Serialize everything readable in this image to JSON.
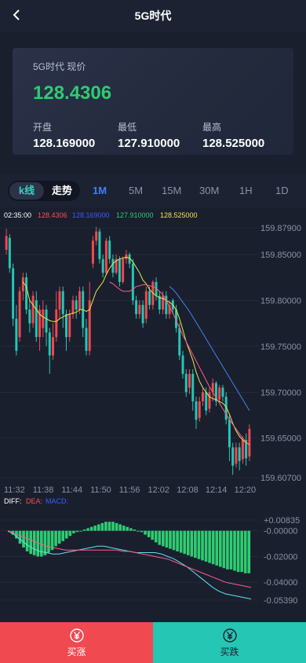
{
  "header": {
    "title": "5G时代",
    "back_icon": "back-chevron-icon"
  },
  "quote": {
    "label": "5G时代 现价",
    "price": "128.4306",
    "price_color": "#2ecc71",
    "stats": [
      {
        "key": "开盘",
        "value": "128.169000"
      },
      {
        "key": "最低",
        "value": "127.910000"
      },
      {
        "key": "最高",
        "value": "128.525000"
      }
    ]
  },
  "tabs": {
    "segment": [
      "k线",
      "走势"
    ],
    "intervals": [
      "1M",
      "5M",
      "15M",
      "30M",
      "1H",
      "1D"
    ],
    "active_interval": "1M"
  },
  "chart_info": {
    "time": "02:35:00",
    "v1": "128.4306",
    "v2": "128.169000",
    "v3": "127.910000",
    "v4": "128.525000"
  },
  "chart_data": {
    "type": "candlestick",
    "y_axis_labels": [
      "159.87900",
      "159.85000",
      "159.80000",
      "159.75000",
      "159.70000",
      "159.65000",
      "159.60700"
    ],
    "ylim": [
      159.607,
      159.879
    ],
    "x_axis_labels": [
      "11:32",
      "11:38",
      "11:44",
      "11:50",
      "11:56",
      "12:02",
      "12:08",
      "12:14",
      "12:20"
    ],
    "candles": [
      [
        159.855,
        159.87,
        159.878,
        159.85
      ],
      [
        159.868,
        159.835,
        159.872,
        159.83
      ],
      [
        159.835,
        159.78,
        159.84,
        159.772
      ],
      [
        159.78,
        159.745,
        159.795,
        159.74
      ],
      [
        159.76,
        159.81,
        159.815,
        159.755
      ],
      [
        159.81,
        159.825,
        159.83,
        159.8
      ],
      [
        159.825,
        159.79,
        159.83,
        159.785
      ],
      [
        159.79,
        159.775,
        159.8,
        159.765
      ],
      [
        159.775,
        159.805,
        159.81,
        159.77
      ],
      [
        159.8,
        159.76,
        159.81,
        159.755
      ],
      [
        159.76,
        159.79,
        159.795,
        159.745
      ],
      [
        159.77,
        159.79,
        159.8,
        159.76
      ],
      [
        159.79,
        159.765,
        159.795,
        159.75
      ],
      [
        159.765,
        159.74,
        159.77,
        159.72
      ],
      [
        159.74,
        159.76,
        159.775,
        159.735
      ],
      [
        159.76,
        159.79,
        159.81,
        159.755
      ],
      [
        159.79,
        159.81,
        159.815,
        159.78
      ],
      [
        159.81,
        159.785,
        159.815,
        159.77
      ],
      [
        159.785,
        159.76,
        159.79,
        159.745
      ],
      [
        159.76,
        159.785,
        159.79,
        159.755
      ],
      [
        159.785,
        159.8,
        159.805,
        159.78
      ],
      [
        159.8,
        159.79,
        159.805,
        159.78
      ],
      [
        159.79,
        159.81,
        159.815,
        159.785
      ],
      [
        159.81,
        159.77,
        159.815,
        159.76
      ],
      [
        159.77,
        159.745,
        159.78,
        159.74
      ],
      [
        159.745,
        159.8,
        159.82,
        159.74
      ],
      [
        159.84,
        159.865,
        159.87,
        159.835
      ],
      [
        159.865,
        159.875,
        159.88,
        159.86
      ],
      [
        159.875,
        159.845,
        159.878,
        159.84
      ],
      [
        159.845,
        159.83,
        159.85,
        159.825
      ],
      [
        159.83,
        159.865,
        159.868,
        159.828
      ],
      [
        159.865,
        159.845,
        159.87,
        159.84
      ],
      [
        159.845,
        159.83,
        159.85,
        159.825
      ],
      [
        159.83,
        159.845,
        159.85,
        159.828
      ],
      [
        159.845,
        159.82,
        159.848,
        159.815
      ],
      [
        159.82,
        159.845,
        159.848,
        159.818
      ],
      [
        159.845,
        159.85,
        159.855,
        159.84
      ],
      [
        159.85,
        159.84,
        159.852,
        159.835
      ],
      [
        159.84,
        159.8,
        159.845,
        159.795
      ],
      [
        159.8,
        159.785,
        159.805,
        159.78
      ],
      [
        159.785,
        159.795,
        159.8,
        159.78
      ],
      [
        159.795,
        159.775,
        159.8,
        159.77
      ],
      [
        159.78,
        159.81,
        159.815,
        159.775
      ],
      [
        159.81,
        159.795,
        159.815,
        159.79
      ],
      [
        159.795,
        159.82,
        159.822,
        159.79
      ],
      [
        159.82,
        159.805,
        159.825,
        159.8
      ],
      [
        159.805,
        159.79,
        159.81,
        159.785
      ],
      [
        159.79,
        159.805,
        159.81,
        159.785
      ],
      [
        159.805,
        159.785,
        159.81,
        159.78
      ],
      [
        159.785,
        159.795,
        159.8,
        159.78
      ],
      [
        159.8,
        159.79,
        159.802,
        159.785
      ],
      [
        159.79,
        159.77,
        159.795,
        159.765
      ],
      [
        159.77,
        159.74,
        159.775,
        159.735
      ],
      [
        159.74,
        159.72,
        159.745,
        159.715
      ],
      [
        159.72,
        159.7,
        159.725,
        159.695
      ],
      [
        159.705,
        159.72,
        159.725,
        159.698
      ],
      [
        159.72,
        159.69,
        159.725,
        159.68
      ],
      [
        159.69,
        159.67,
        159.695,
        159.66
      ],
      [
        159.672,
        159.69,
        159.695,
        159.668
      ],
      [
        159.69,
        159.7,
        159.705,
        159.685
      ],
      [
        159.7,
        159.68,
        159.705,
        159.675
      ],
      [
        159.682,
        159.7,
        159.705,
        159.678
      ],
      [
        159.7,
        159.71,
        159.715,
        159.69
      ],
      [
        159.71,
        159.69,
        159.712,
        159.685
      ],
      [
        159.692,
        159.705,
        159.708,
        159.688
      ],
      [
        159.705,
        159.695,
        159.708,
        159.69
      ],
      [
        159.695,
        159.67,
        159.7,
        159.665
      ],
      [
        159.67,
        159.64,
        159.675,
        159.625
      ],
      [
        159.64,
        159.62,
        159.645,
        159.61
      ],
      [
        159.622,
        159.64,
        159.645,
        159.618
      ],
      [
        159.64,
        159.625,
        159.645,
        159.615
      ],
      [
        159.627,
        159.648,
        159.652,
        159.622
      ],
      [
        159.648,
        159.628,
        159.655,
        159.62
      ],
      [
        159.63,
        159.66,
        159.665,
        159.625
      ]
    ],
    "ma_lines": [
      {
        "color": "#e8e84a",
        "values": [
          null,
          null,
          null,
          null,
          null,
          159.82,
          159.815,
          159.8,
          159.795,
          159.79,
          159.785,
          159.782,
          159.78,
          159.778,
          159.777,
          159.777,
          159.78,
          159.782,
          159.784,
          159.785,
          159.786,
          159.787,
          159.79,
          159.79,
          159.788,
          159.79,
          159.8,
          159.81,
          159.815,
          159.82,
          159.828,
          159.835,
          159.84,
          159.843,
          159.845,
          159.846,
          159.847,
          159.846,
          159.842,
          159.836,
          159.83,
          159.822,
          159.818,
          159.812,
          159.808,
          159.805,
          159.803,
          159.802,
          159.8,
          159.798,
          159.795,
          159.79,
          159.78,
          159.768,
          159.755,
          159.745,
          159.735,
          159.722,
          159.712,
          159.705,
          159.7,
          159.695,
          159.693,
          159.692,
          159.69,
          159.688,
          159.684,
          159.676,
          159.666,
          159.658,
          159.652,
          159.648,
          159.645,
          159.643
        ]
      },
      {
        "color": "#ff5b8a",
        "values": [
          null,
          null,
          null,
          null,
          null,
          null,
          null,
          null,
          null,
          null,
          null,
          null,
          null,
          null,
          null,
          null,
          null,
          null,
          null,
          null,
          null,
          null,
          null,
          null,
          null,
          null,
          null,
          null,
          null,
          null,
          null,
          159.82,
          159.818,
          159.815,
          159.812,
          159.81,
          159.81,
          159.81,
          159.812,
          159.815,
          159.816,
          159.817,
          159.817,
          159.816,
          159.815,
          159.813,
          159.81,
          159.806,
          159.8,
          159.793,
          159.786,
          159.778,
          159.77,
          159.762,
          159.755,
          159.748,
          159.741,
          159.734,
          159.727,
          159.72,
          159.713,
          159.706,
          159.7,
          159.694,
          159.688,
          159.682,
          159.676,
          159.67,
          159.665,
          159.66,
          159.655,
          159.65,
          159.646,
          159.642
        ]
      },
      {
        "color": "#4a7ff0",
        "values": [
          null,
          null,
          null,
          null,
          null,
          null,
          null,
          null,
          null,
          null,
          null,
          null,
          null,
          null,
          null,
          null,
          null,
          null,
          null,
          null,
          null,
          null,
          null,
          null,
          null,
          null,
          null,
          null,
          null,
          null,
          null,
          null,
          null,
          null,
          null,
          null,
          null,
          null,
          null,
          null,
          null,
          null,
          null,
          null,
          null,
          null,
          null,
          null,
          null,
          159.815,
          159.812,
          159.808,
          159.803,
          159.798,
          159.793,
          159.788,
          159.782,
          159.776,
          159.77,
          159.764,
          159.758,
          159.752,
          159.746,
          159.74,
          159.734,
          159.728,
          159.722,
          159.716,
          159.71,
          159.704,
          159.698,
          159.692,
          159.686,
          159.68
        ]
      }
    ],
    "macd": {
      "labels": {
        "diff": "DIFF:",
        "dea": "DEA:",
        "macd": "MACD:"
      },
      "y_axis_labels": [
        "+0.00835",
        "-0.00000",
        "-0.02000",
        "-0.04000",
        "-0.05390"
      ],
      "ylim": [
        -0.0539,
        0.00835
      ],
      "hist": [
        -0.001,
        -0.003,
        -0.006,
        -0.01,
        -0.013,
        -0.016,
        -0.018,
        -0.019,
        -0.02,
        -0.02,
        -0.019,
        -0.017,
        -0.015,
        -0.012,
        -0.01,
        -0.008,
        -0.006,
        -0.004,
        -0.002,
        -0.001,
        0.0,
        0.001,
        0.002,
        0.003,
        0.004,
        0.005,
        0.006,
        0.007,
        0.007,
        0.007,
        0.006,
        0.005,
        0.004,
        0.003,
        0.002,
        0.001,
        0.0,
        -0.001,
        -0.003,
        -0.005,
        -0.007,
        -0.009,
        -0.011,
        -0.012,
        -0.013,
        -0.014,
        -0.015,
        -0.016,
        -0.017,
        -0.018,
        -0.019,
        -0.02,
        -0.021,
        -0.022,
        -0.023,
        -0.024,
        -0.025,
        -0.026,
        -0.027,
        -0.028,
        -0.029,
        -0.03,
        -0.03,
        -0.031,
        -0.032,
        -0.032,
        -0.033,
        -0.033
      ],
      "diff": [
        0.0,
        -0.003,
        -0.007,
        -0.011,
        -0.014,
        -0.016,
        -0.017,
        -0.018,
        -0.018,
        -0.017,
        -0.016,
        -0.015,
        -0.014,
        -0.013,
        -0.012,
        -0.012,
        -0.013,
        -0.014,
        -0.015,
        -0.016,
        -0.017,
        -0.017,
        -0.017,
        -0.017,
        -0.018,
        -0.02,
        -0.022,
        -0.025,
        -0.028,
        -0.032,
        -0.036,
        -0.04,
        -0.044,
        -0.047,
        -0.049,
        -0.05,
        -0.051,
        -0.052,
        -0.053
      ],
      "dea": [
        0.0,
        -0.002,
        -0.004,
        -0.006,
        -0.008,
        -0.01,
        -0.012,
        -0.013,
        -0.014,
        -0.015,
        -0.015,
        -0.015,
        -0.015,
        -0.015,
        -0.015,
        -0.015,
        -0.015,
        -0.015,
        -0.016,
        -0.016,
        -0.017,
        -0.018,
        -0.019,
        -0.02,
        -0.021,
        -0.022,
        -0.024,
        -0.026,
        -0.028,
        -0.03,
        -0.032,
        -0.034,
        -0.036,
        -0.038,
        -0.04,
        -0.041,
        -0.042,
        -0.043,
        -0.044
      ]
    }
  },
  "actions": {
    "buy_label": "买涨",
    "buy_icon": "yen-circle-icon",
    "sell_label": "买跌",
    "sell_icon": "yen-circle-icon"
  },
  "colors": {
    "up": "#f04950",
    "down": "#26c6b4",
    "accent": "#3b82f6",
    "buy_bg": "#f04950",
    "sell_bg": "#26c6b4"
  }
}
